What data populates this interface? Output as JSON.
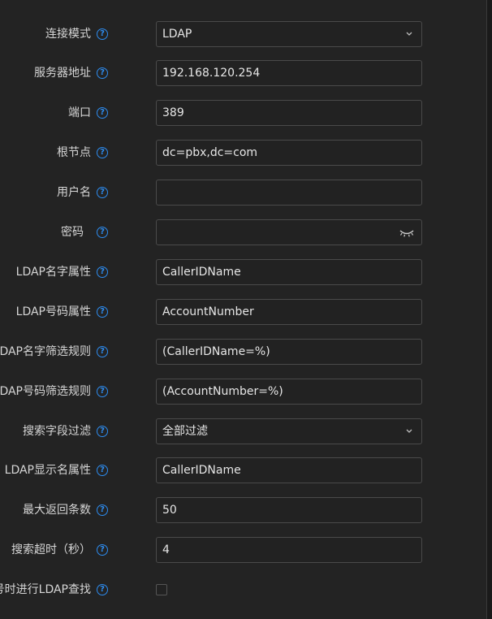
{
  "fields": [
    {
      "label": "连接模式",
      "value": "LDAP",
      "type": "select"
    },
    {
      "label": "服务器地址",
      "value": "192.168.120.254",
      "type": "text"
    },
    {
      "label": "端口",
      "value": "389",
      "type": "text"
    },
    {
      "label": "根节点",
      "value": "dc=pbx,dc=com",
      "type": "text"
    },
    {
      "label": "用户名",
      "value": "",
      "type": "text"
    },
    {
      "label": "密码",
      "value": "",
      "type": "password"
    },
    {
      "label": "LDAP名字属性",
      "value": "CallerIDName",
      "type": "text"
    },
    {
      "label": "LDAP号码属性",
      "value": "AccountNumber",
      "type": "text"
    },
    {
      "label": "LDAP名字筛选规则",
      "value": "(CallerIDName=%)",
      "type": "text"
    },
    {
      "label": "LDAP号码筛选规则",
      "value": "(AccountNumber=%)",
      "type": "text"
    },
    {
      "label": "搜索字段过滤",
      "value": "全部过滤",
      "type": "select"
    },
    {
      "label": "LDAP显示名属性",
      "value": "CallerIDName",
      "type": "text"
    },
    {
      "label": "最大返回条数",
      "value": "50",
      "type": "text"
    },
    {
      "label": "搜索超时（秒）",
      "value": "4",
      "type": "text"
    },
    {
      "label": "拨号时进行LDAP查找",
      "value": "",
      "type": "checkbox",
      "checked": false
    }
  ],
  "help_glyph": "?",
  "colors": {
    "background": "#232323",
    "accent": "#2d8cf0",
    "border": "#4a4a4a"
  },
  "icons": {
    "help": "question-circle-icon",
    "select": "chevron-down-icon",
    "password": "eye-closed-icon"
  }
}
